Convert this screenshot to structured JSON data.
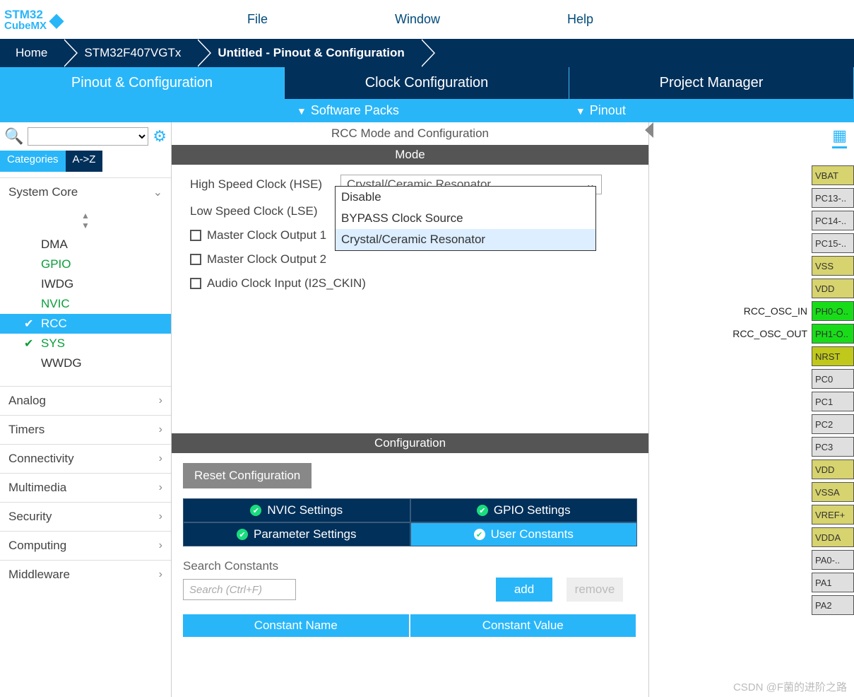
{
  "logo": {
    "line1": "STM32",
    "line2": "CubeMX"
  },
  "menu": {
    "file": "File",
    "window": "Window",
    "help": "Help"
  },
  "breadcrumb": {
    "home": "Home",
    "device": "STM32F407VGTx",
    "page": "Untitled - Pinout & Configuration"
  },
  "tabs": {
    "pinout": "Pinout & Configuration",
    "clock": "Clock Configuration",
    "project": "Project Manager"
  },
  "subbar": {
    "packs": "Software Packs",
    "pinout": "Pinout"
  },
  "left": {
    "cat": "Categories",
    "az": "A->Z",
    "groups": {
      "systemcore": "System Core",
      "analog": "Analog",
      "timers": "Timers",
      "connectivity": "Connectivity",
      "multimedia": "Multimedia",
      "security": "Security",
      "computing": "Computing",
      "middleware": "Middleware"
    },
    "tree": {
      "dma": "DMA",
      "gpio": "GPIO",
      "iwdg": "IWDG",
      "nvic": "NVIC",
      "rcc": "RCC",
      "sys": "SYS",
      "wwdg": "WWDG"
    }
  },
  "center": {
    "title": "RCC Mode and Configuration",
    "mode": "Mode",
    "hse_label": "High Speed Clock (HSE)",
    "hse_value": "Crystal/Ceramic Resonator",
    "lse_label": "Low Speed Clock (LSE)",
    "options": {
      "disable": "Disable",
      "bypass": "BYPASS Clock Source",
      "crystal": "Crystal/Ceramic Resonator"
    },
    "mco1": "Master Clock Output 1",
    "mco2": "Master Clock Output 2",
    "audio": "Audio Clock Input (I2S_CKIN)",
    "config": "Configuration",
    "reset": "Reset Configuration",
    "tabs": {
      "nvic": "NVIC Settings",
      "gpio": "GPIO Settings",
      "param": "Parameter Settings",
      "user": "User Constants"
    },
    "constants": {
      "label": "Search Constants",
      "placeholder": "Search (Ctrl+F)",
      "add": "add",
      "remove": "remove",
      "col1": "Constant Name",
      "col2": "Constant Value"
    }
  },
  "right": {
    "signals": {
      "osc_in": "RCC_OSC_IN",
      "osc_out": "RCC_OSC_OUT"
    },
    "pins": [
      "VBAT",
      "PC13-..",
      "PC14-..",
      "PC15-..",
      "VSS",
      "VDD",
      "PH0-O..",
      "PH1-O..",
      "NRST",
      "PC0",
      "PC1",
      "PC2",
      "PC3",
      "VDD",
      "VSSA",
      "VREF+",
      "VDDA",
      "PA0-..",
      "PA1",
      "PA2"
    ]
  },
  "watermark": "CSDN @F菌的进阶之路"
}
